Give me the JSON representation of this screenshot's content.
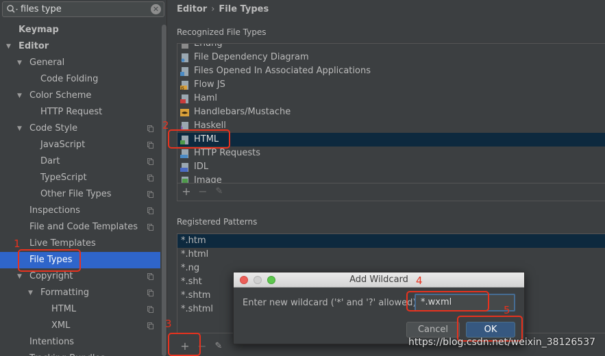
{
  "search": {
    "value": "files type",
    "icon": "search-icon",
    "clear_icon": "clear-icon"
  },
  "sidebar": {
    "items": [
      {
        "label": "Keymap",
        "expanded": null
      },
      {
        "label": "Editor",
        "expanded": true
      },
      {
        "label": "General",
        "expanded": true
      },
      {
        "label": "Code Folding"
      },
      {
        "label": "Color Scheme",
        "expanded": true
      },
      {
        "label": "HTTP Request"
      },
      {
        "label": "Code Style",
        "expanded": true
      },
      {
        "label": "JavaScript"
      },
      {
        "label": "Dart"
      },
      {
        "label": "TypeScript"
      },
      {
        "label": "Other File Types"
      },
      {
        "label": "Inspections"
      },
      {
        "label": "File and Code Templates"
      },
      {
        "label": "Live Templates"
      },
      {
        "label": "File Types",
        "selected": true
      },
      {
        "label": "Copyright",
        "expanded": true
      },
      {
        "label": "Formatting",
        "expanded": true
      },
      {
        "label": "HTML"
      },
      {
        "label": "XML"
      },
      {
        "label": "Intentions"
      },
      {
        "label": "Tracking Bundles"
      }
    ]
  },
  "breadcrumb": {
    "parent": "Editor",
    "separator": "›",
    "current": "File Types"
  },
  "recognized": {
    "title": "Recognized File Types",
    "items": [
      {
        "label": "Erlang",
        "icon": "erlang-file-icon"
      },
      {
        "label": "File Dependency Diagram",
        "icon": "diagram-file-icon"
      },
      {
        "label": "Files Opened In Associated Applications",
        "icon": "external-file-icon"
      },
      {
        "label": "Flow JS",
        "icon": "js-file-icon"
      },
      {
        "label": "Haml",
        "icon": "haml-file-icon"
      },
      {
        "label": "Handlebars/Mustache",
        "icon": "handlebars-file-icon"
      },
      {
        "label": "Haskell",
        "icon": "haskell-file-icon"
      },
      {
        "label": "HTML",
        "icon": "html-file-icon",
        "selected": true
      },
      {
        "label": "HTTP Requests",
        "icon": "http-api-file-icon"
      },
      {
        "label": "IDL",
        "icon": "idl-file-icon"
      },
      {
        "label": "Image",
        "icon": "image-file-icon"
      }
    ]
  },
  "patterns": {
    "title": "Registered Patterns",
    "items": [
      "*.htm",
      "*.html",
      "*.ng",
      "*.sht",
      "*.shtm",
      "*.shtml"
    ]
  },
  "toolbar": {
    "add": "+",
    "remove": "−",
    "edit": "✎"
  },
  "dialog": {
    "title": "Add Wildcard",
    "prompt": "Enter new wildcard ('*' and '?' allowed)",
    "value": "*.wxml",
    "cancel": "Cancel",
    "ok": "OK"
  },
  "annotations": [
    "1",
    "2",
    "3",
    "4",
    "5"
  ],
  "annotation_color": "#e8321e",
  "selection_color": "#2f65ca",
  "watermark": "https://blog.csdn.net/weixin_38126537"
}
